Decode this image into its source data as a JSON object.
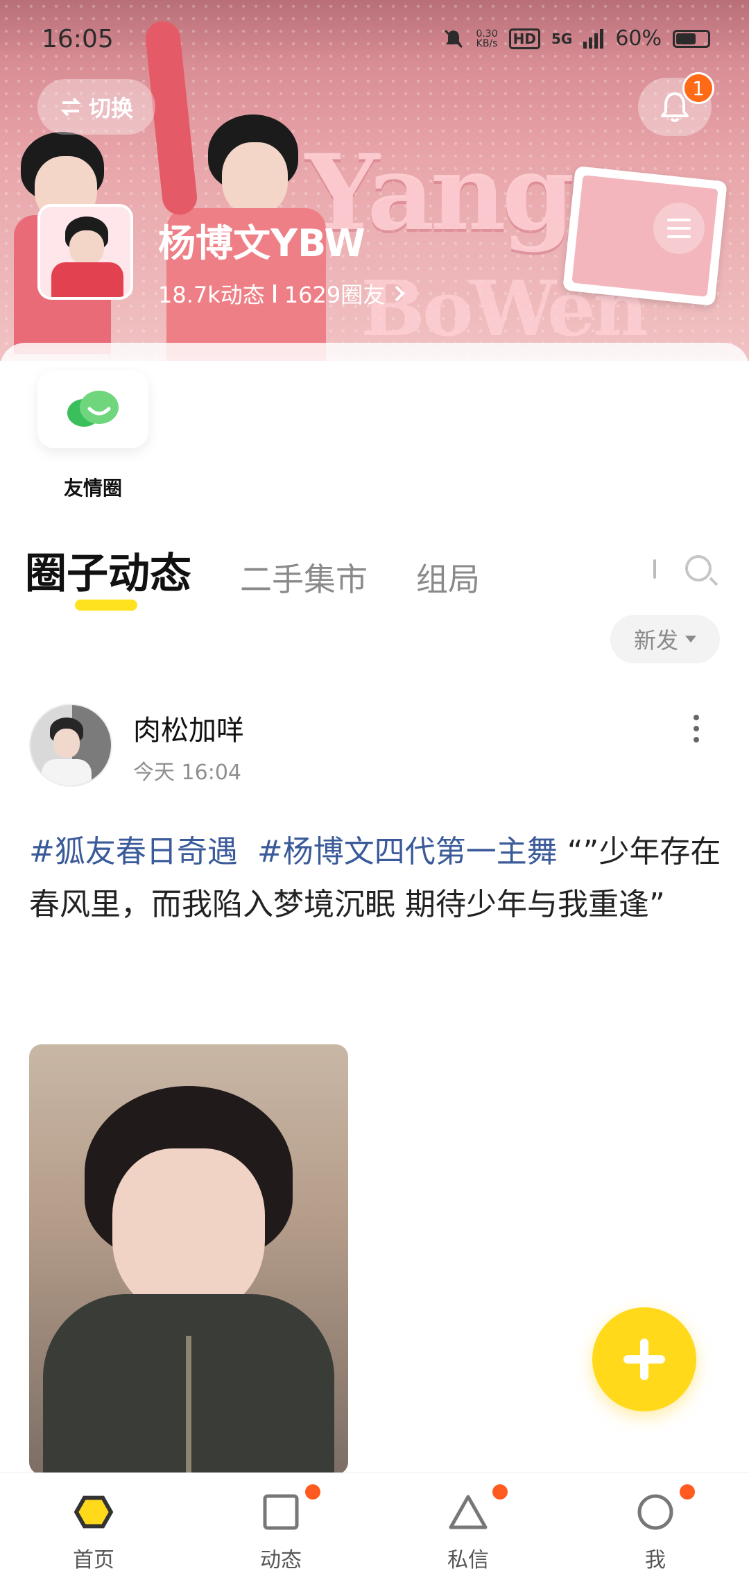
{
  "status_bar": {
    "time": "16:05",
    "net_speed_value": "0.30",
    "net_speed_unit": "KB/s",
    "hd": "HD",
    "network": "5G",
    "battery": "60%"
  },
  "header": {
    "switch_label": "切换",
    "notification_count": "1",
    "circle_name": "杨博文YBW",
    "posts_count": "18.7k动态",
    "members_count": "1629圈友"
  },
  "banner_decor": {
    "word1": "Yang",
    "word2": "BoWen"
  },
  "quick_entries": [
    {
      "label": "友情圈",
      "icon": "chat-bubble-icon"
    }
  ],
  "tabs": [
    {
      "label": "圈子动态",
      "active": true
    },
    {
      "label": "二手集市",
      "active": false
    },
    {
      "label": "组局",
      "active": false
    }
  ],
  "sort": {
    "label": "新发"
  },
  "post": {
    "author": "肉松加咩",
    "time": "今天 16:04",
    "tag1": "#狐友春日奇遇",
    "tag2": "#杨博文四代第一主舞",
    "text": "“”少年存在春风里，而我陷入梦境沉眠 期待少年与我重逢”"
  },
  "bottom_nav": [
    {
      "label": "首页",
      "icon": "home-hexagon-icon",
      "badge": false,
      "active": true
    },
    {
      "label": "动态",
      "icon": "square-icon",
      "badge": true,
      "active": false
    },
    {
      "label": "私信",
      "icon": "triangle-icon",
      "badge": true,
      "active": false
    },
    {
      "label": "我",
      "icon": "circle-icon",
      "badge": true,
      "active": false
    }
  ],
  "colors": {
    "accent_yellow": "#ffd91a",
    "badge_orange": "#ff6a16",
    "tag_blue": "#3a5a9a"
  }
}
